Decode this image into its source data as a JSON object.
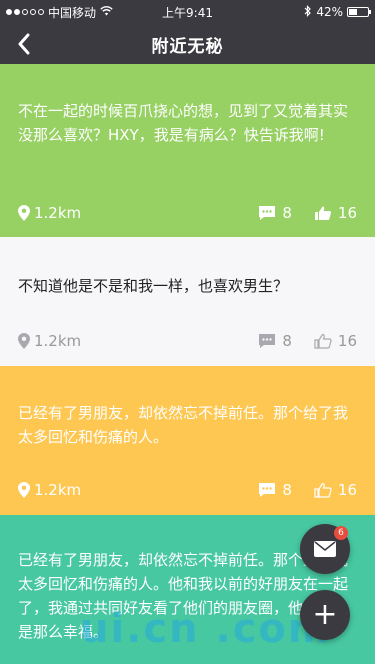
{
  "status": {
    "carrier": "中国移动",
    "time": "上午9:41",
    "battery": "42%",
    "battery_level": 0.42
  },
  "nav": {
    "title": "附近无秘"
  },
  "posts": [
    {
      "text": "不在一起的时候百爪挠心的想，见到了又觉着其实没那么喜欢？HXY，我是有病么？快告诉我啊!",
      "distance": "1.2km",
      "comments": "8",
      "likes": "16",
      "bg": "#97d063"
    },
    {
      "text": "不知道他是不是和我一样，也喜欢男生？",
      "distance": "1.2km",
      "comments": "8",
      "likes": "16",
      "bg": "#f7f7f9"
    },
    {
      "text": "已经有了男朋友，却依然忘不掉前任。那个给了我太多回忆和伤痛的人。",
      "distance": "1.2km",
      "comments": "8",
      "likes": "16",
      "bg": "#fdc752"
    },
    {
      "text": "已经有了男朋友，却依然忘不掉前任。那个给了我太多回忆和伤痛的人。他和我以前的好朋友在一起了，我通过共同好友看了他们的朋友圈，他们现在是那么幸福。",
      "bg": "#47c8a0"
    }
  ],
  "fab": {
    "mail_badge": "6",
    "add_glyph": "+"
  },
  "watermark": {
    "text": "ui.cn .com"
  },
  "icons": {
    "back": "chevron-left-icon",
    "location": "location-pin-icon",
    "comment": "comment-icon",
    "like": "thumbs-up-icon",
    "mail": "mail-icon",
    "add": "plus-icon"
  }
}
